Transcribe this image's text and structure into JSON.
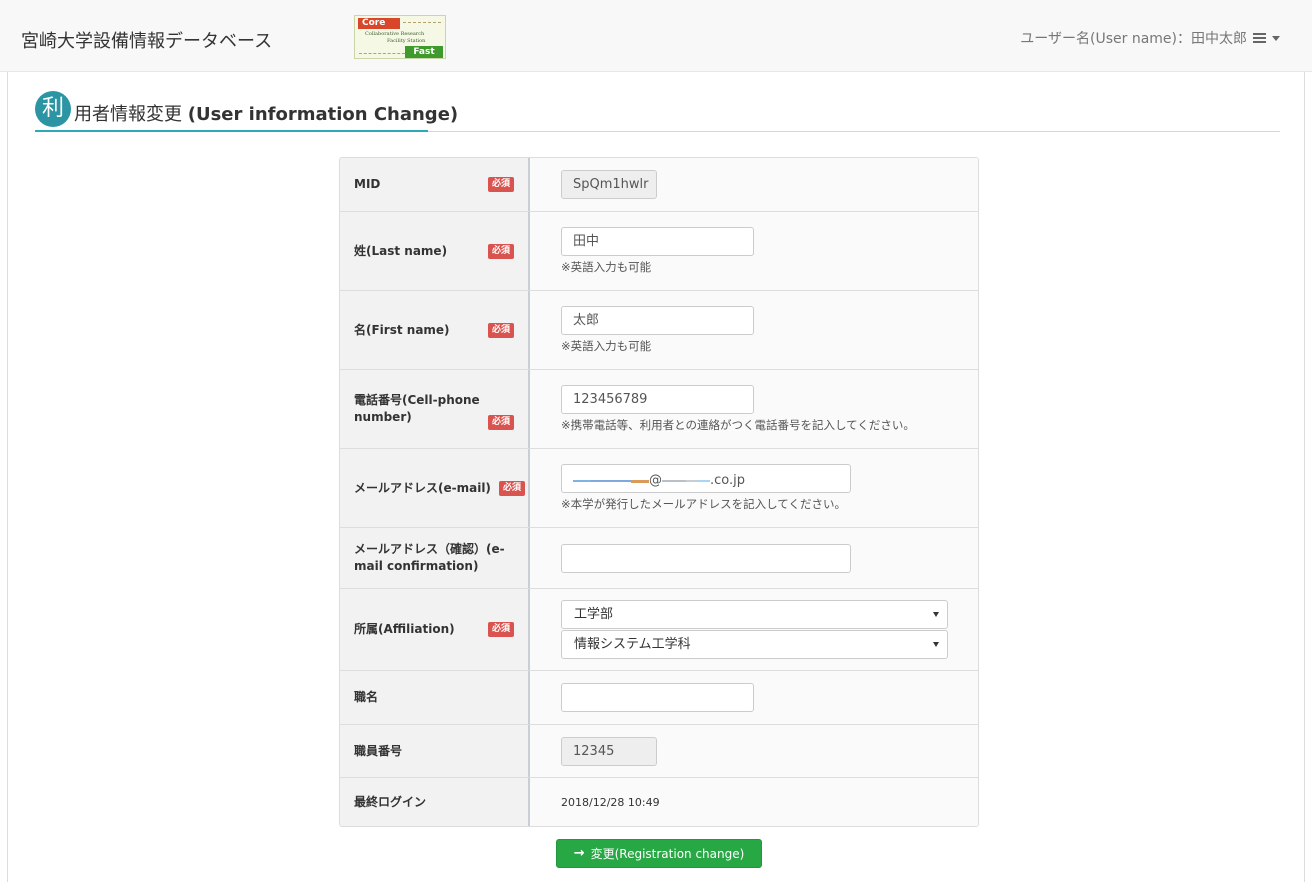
{
  "header": {
    "site_title": "宮崎大学設備情報データベース",
    "logo": {
      "core": "Core",
      "sub_line1": "Collaborative  Research",
      "sub_line2": "Facility  Station",
      "fast": "Fast"
    },
    "user_label": "ユーザー名(User name)：田中太郎"
  },
  "page": {
    "badge_char": "利",
    "title_jp": "用者情報変更",
    "title_en": "(User information Change)"
  },
  "form": {
    "required_label": "必須",
    "mid": {
      "label": "MID",
      "value": "SpQm1hwlr"
    },
    "last_name": {
      "label": "姓(Last name)",
      "value": "田中",
      "hint": "※英語入力も可能"
    },
    "first_name": {
      "label": "名(First name)",
      "value": "太郎",
      "hint": "※英語入力も可能"
    },
    "phone": {
      "label": "電話番号(Cell-phone number)",
      "value": "123456789",
      "hint": "※携帯電話等、利用者との連絡がつく電話番号を記入してください。"
    },
    "email": {
      "label": "メールアドレス(e-mail)",
      "at": "@",
      "domain_suffix": ".co.jp",
      "hint": "※本学が発行したメールアドレスを記入してください。"
    },
    "email_confirm": {
      "label": "メールアドレス（確認）(e-mail confirmation)",
      "value": ""
    },
    "affiliation": {
      "label": "所属(Affiliation)",
      "faculty": "工学部",
      "department": "情報システム工学科"
    },
    "job_title": {
      "label": "職名",
      "value": ""
    },
    "staff_number": {
      "label": "職員番号",
      "value": "12345"
    },
    "last_login": {
      "label": "最終ログイン",
      "value": "2018/12/28 10:49"
    }
  },
  "submit": {
    "label": "変更(Registration change)"
  },
  "colors": {
    "accent_teal": "#2b95a4",
    "required_red": "#d9534f",
    "submit_green": "#28a745"
  }
}
